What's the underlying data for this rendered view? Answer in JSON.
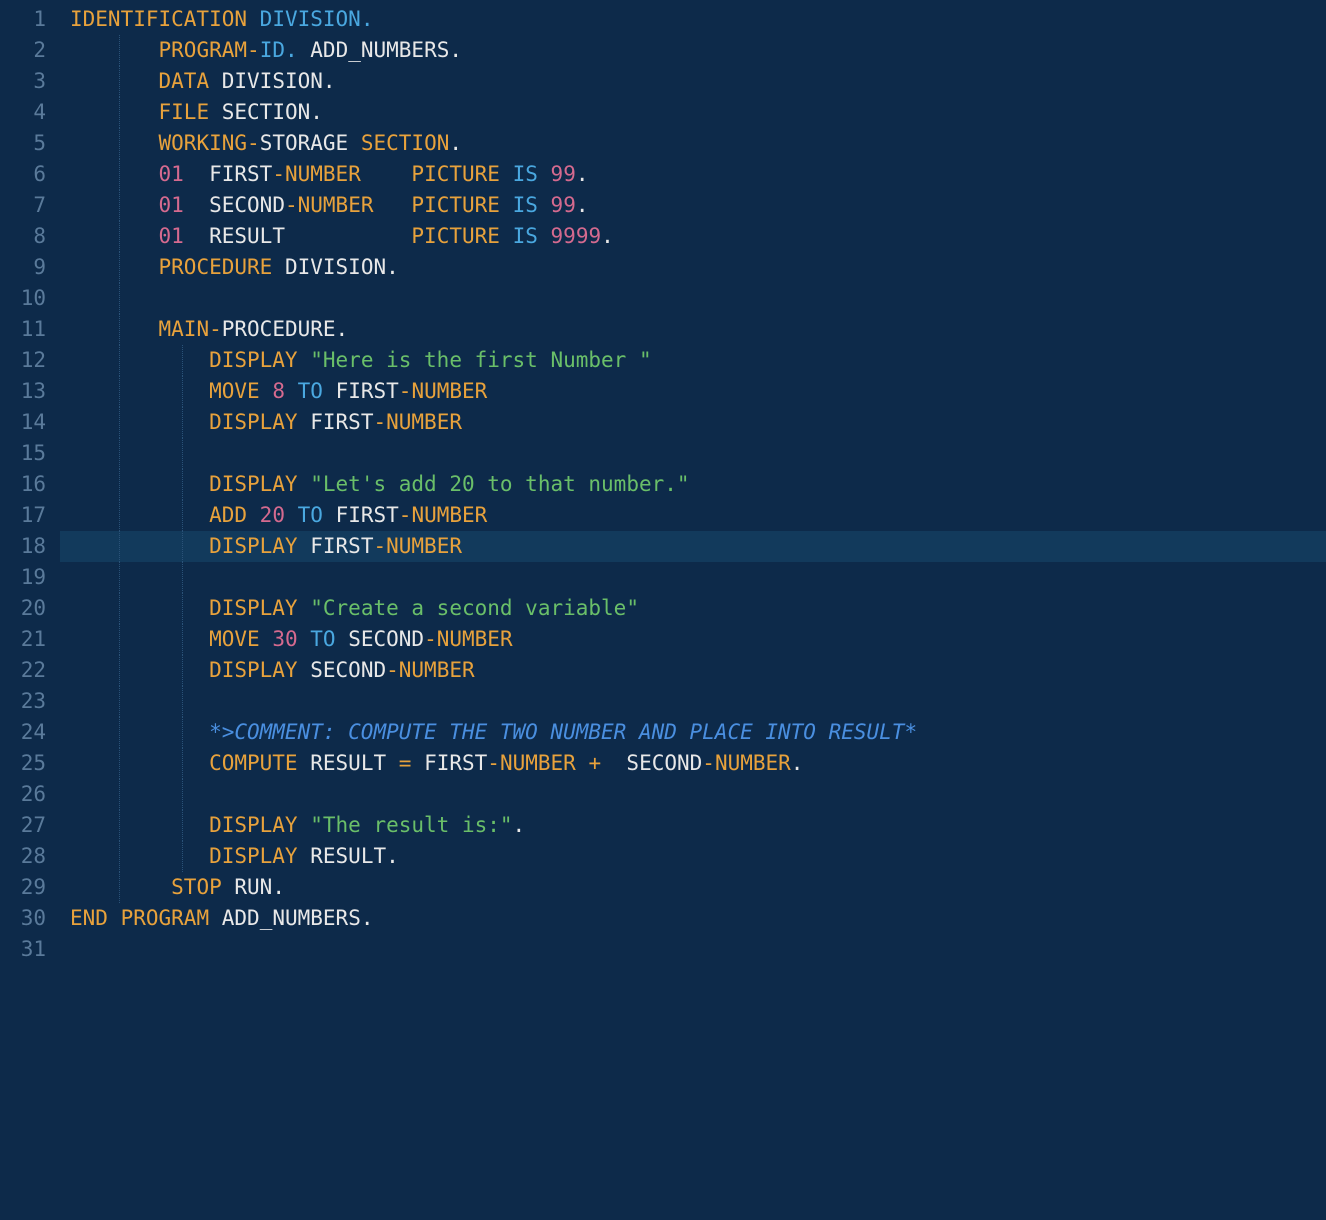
{
  "gutter": [
    "1",
    "2",
    "3",
    "4",
    "5",
    "6",
    "7",
    "8",
    "9",
    "10",
    "11",
    "12",
    "13",
    "14",
    "15",
    "16",
    "17",
    "18",
    "19",
    "20",
    "21",
    "22",
    "23",
    "24",
    "25",
    "26",
    "27",
    "28",
    "29",
    "30",
    "31"
  ],
  "highlighted_line": 18,
  "code": {
    "l1": {
      "a": "IDENTIFICATION",
      "b": "DIVISION."
    },
    "l2": {
      "a": "PROGRAM",
      "b": "ID.",
      "c": "ADD_NUMBERS."
    },
    "l3": {
      "a": "DATA",
      "b": "DIVISION."
    },
    "l4": {
      "a": "FILE",
      "b": "SECTION."
    },
    "l5": {
      "a": "WORKING",
      "b": "STORAGE",
      "c": "SECTION",
      "d": "."
    },
    "l6": {
      "a": "01",
      "b": "FIRST",
      "c": "NUMBER",
      "d": "PICTURE",
      "e": "IS",
      "f": "99",
      "g": "."
    },
    "l7": {
      "a": "01",
      "b": "SECOND",
      "c": "NUMBER",
      "d": "PICTURE",
      "e": "IS",
      "f": "99",
      "g": "."
    },
    "l8": {
      "a": "01",
      "b": "RESULT",
      "d": "PICTURE",
      "e": "IS",
      "f": "9999",
      "g": "."
    },
    "l9": {
      "a": "PROCEDURE",
      "b": "DIVISION."
    },
    "l11": {
      "a": "MAIN",
      "b": "PROCEDURE."
    },
    "l12": {
      "a": "DISPLAY",
      "b": "\"Here is the first Number \""
    },
    "l13": {
      "a": "MOVE",
      "b": "8",
      "c": "TO",
      "d": "FIRST",
      "e": "NUMBER"
    },
    "l14": {
      "a": "DISPLAY",
      "b": "FIRST",
      "c": "NUMBER"
    },
    "l16": {
      "a": "DISPLAY",
      "b": "\"Let's add 20 to that number.\""
    },
    "l17": {
      "a": "ADD",
      "b": "20",
      "c": "TO",
      "d": "FIRST",
      "e": "NUMBER"
    },
    "l18": {
      "a": "DISPLAY",
      "b": "FIRST",
      "c": "NUMBER"
    },
    "l20": {
      "a": "DISPLAY",
      "b": "\"Create a second variable\""
    },
    "l21": {
      "a": "MOVE",
      "b": "30",
      "c": "TO",
      "d": "SECOND",
      "e": "NUMBER"
    },
    "l22": {
      "a": "DISPLAY",
      "b": "SECOND",
      "c": "NUMBER"
    },
    "l24": {
      "a": "*>COMMENT: COMPUTE THE TWO NUMBER AND PLACE INTO RESULT*"
    },
    "l25": {
      "a": "COMPUTE",
      "b": "RESULT",
      "c": "=",
      "d": "FIRST",
      "e": "NUMBER",
      "f": "+",
      "g": "SECOND",
      "h": "NUMBER",
      "i": "."
    },
    "l27": {
      "a": "DISPLAY",
      "b": "\"The result is:\"",
      "c": "."
    },
    "l28": {
      "a": "DISPLAY",
      "b": "RESULT."
    },
    "l29": {
      "a": "STOP",
      "b": "RUN."
    },
    "l30": {
      "a": "END",
      "b": "PROGRAM",
      "c": "ADD_NUMBERS."
    }
  }
}
